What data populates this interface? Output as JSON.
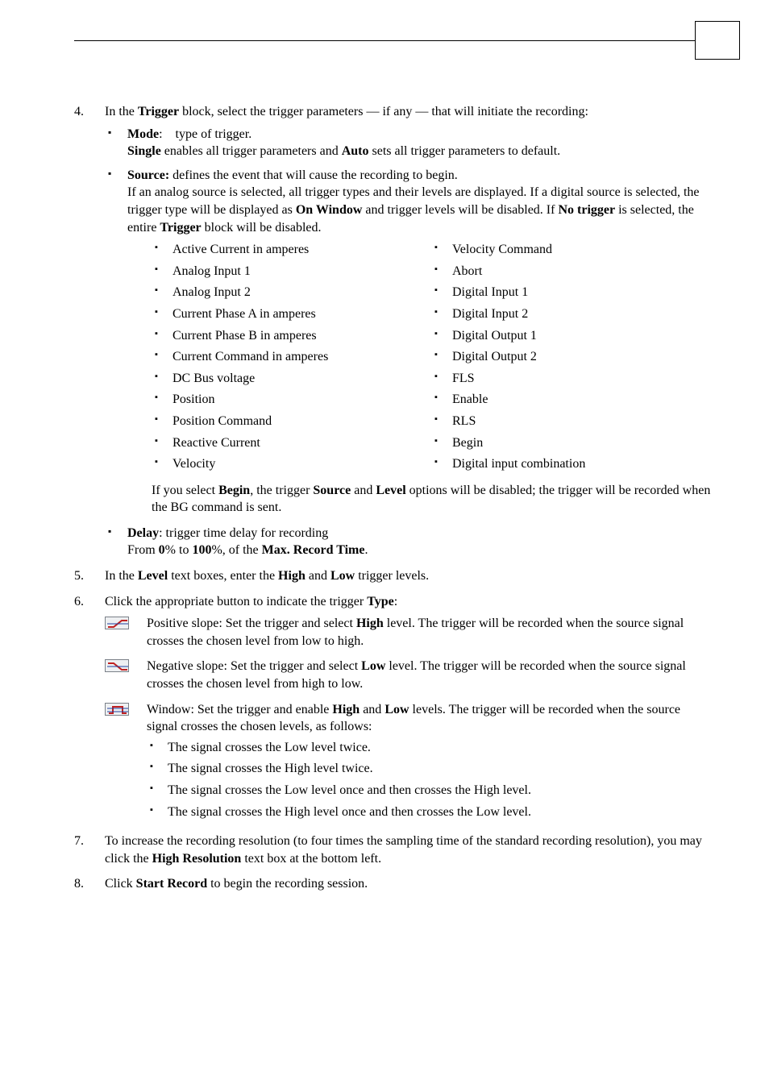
{
  "step4": {
    "num": "4.",
    "intro_a": "In the ",
    "intro_b": "Trigger",
    "intro_c": " block, select the trigger parameters  —  if any  —  that will initiate the recording:",
    "mode_label": "Mode",
    "mode_after": ":    type of trigger.",
    "mode_b1": "Single",
    "mode_mid": " enables all trigger parameters and ",
    "mode_b2": "Auto",
    "mode_end": " sets all trigger parameters to default.",
    "source_label": "Source:",
    "source_after": " defines the event that will cause the recording to begin.",
    "source_p_a": "If an analog source is selected, all trigger types and their levels are displayed. If a digital source is selected, the trigger type will be displayed as ",
    "source_p_b": "On Window",
    "source_p_c": " and trigger levels will be disabled. If ",
    "source_p_d": "No trigger",
    "source_p_e": " is selected, the entire ",
    "source_p_f": "Trigger",
    "source_p_g": " block will be disabled.",
    "left": [
      "Active Current in amperes",
      "Analog Input 1",
      "Analog Input 2",
      "Current Phase A in amperes",
      "Current Phase B in amperes",
      "Current Command in amperes",
      "DC Bus voltage",
      "Position",
      "Position Command",
      "Reactive Current",
      "Velocity"
    ],
    "right": [
      "Velocity Command",
      "Abort",
      "Digital Input 1",
      "Digital Input 2",
      "Digital Output 1",
      "Digital Output 2",
      "FLS",
      "Enable",
      "RLS",
      "Begin",
      "Digital input combination"
    ],
    "begin_a": "If you select ",
    "begin_b": "Begin",
    "begin_c": ", the trigger ",
    "begin_d": "Source",
    "begin_e": " and ",
    "begin_f": "Level",
    "begin_g": " options will be disabled; the trigger will be recorded when the BG command is sent.",
    "delay_label": "Delay",
    "delay_after": ": trigger time delay for recording",
    "delay_a": "From ",
    "delay_b": "0",
    "delay_c": "% to ",
    "delay_d": "100",
    "delay_e": "%, of the ",
    "delay_f": "Max. Record Time",
    "delay_g": "."
  },
  "step5": {
    "num": "5.",
    "a": "In the ",
    "b": "Level",
    "c": " text boxes, enter the ",
    "d": "High",
    "e": " and ",
    "f": "Low",
    "g": " trigger levels."
  },
  "step6": {
    "num": "6.",
    "a": "Click the appropriate button to indicate the trigger ",
    "b": "Type",
    "c": ":",
    "pos_a": "Positive slope: Set the trigger and select ",
    "pos_b": "High",
    "pos_c": " level. The trigger will be recorded when the source signal crosses the chosen level from low to high.",
    "neg_a": "Negative slope: Set the trigger and select ",
    "neg_b": "Low",
    "neg_c": " level. The trigger will be recorded when the source signal crosses the chosen level from high to low.",
    "win_a": "Window: Set the trigger and enable ",
    "win_b": "High",
    "win_c": " and ",
    "win_d": "Low",
    "win_e": " levels. The trigger will be recorded when the source signal crosses the chosen levels, as follows:",
    "win_items": [
      "The signal crosses the Low level twice.",
      "The signal crosses the High level twice.",
      "The signal crosses the Low level once and then crosses the High level.",
      "The signal crosses the High level once and then crosses the Low level."
    ]
  },
  "step7": {
    "num": "7.",
    "a": "To increase the recording resolution (to four times the sampling time of the standard recording resolution), you may click the ",
    "b": "High Resolution",
    "c": " text box at the bottom left."
  },
  "step8": {
    "num": "8.",
    "a": "Click ",
    "b": "Start Record",
    "c": " to begin the recording session."
  }
}
